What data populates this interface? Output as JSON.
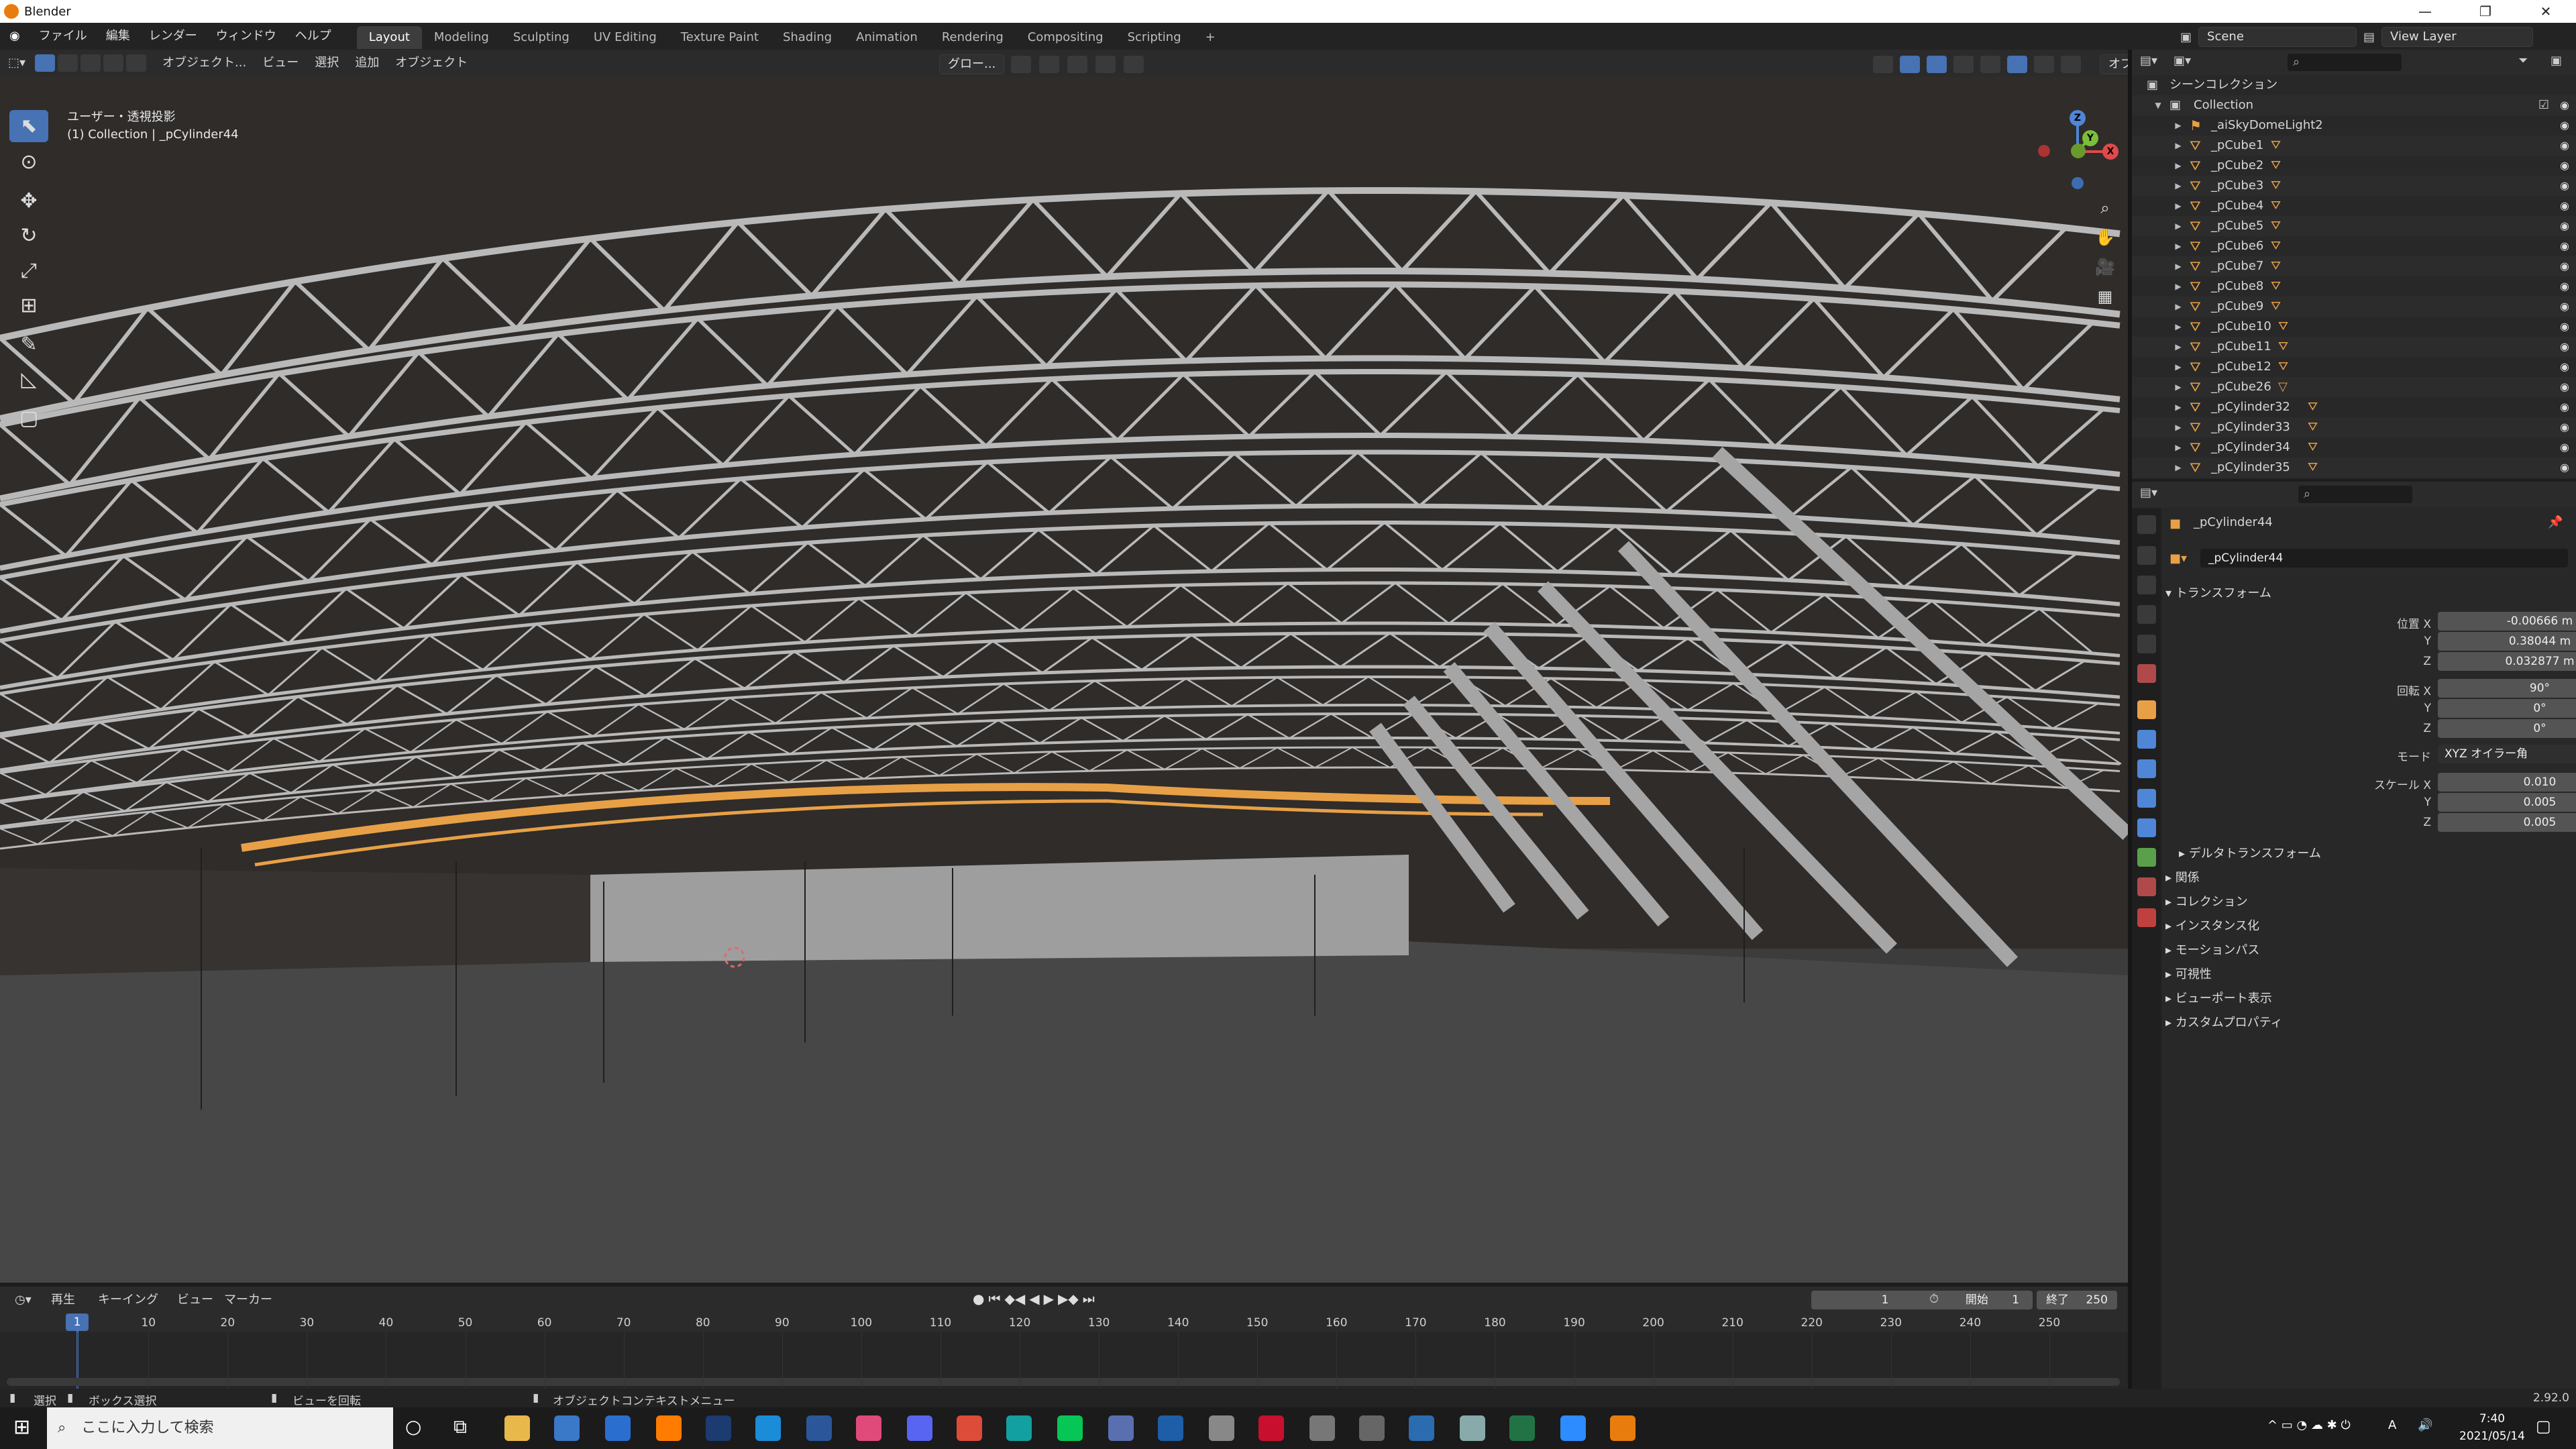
{
  "window": {
    "title": "Blender"
  },
  "topbar": {
    "menus": [
      "ファイル",
      "編集",
      "レンダー",
      "ウィンドウ",
      "ヘルプ"
    ],
    "workspaces": [
      "Layout",
      "Modeling",
      "Sculpting",
      "UV Editing",
      "Texture Paint",
      "Shading",
      "Animation",
      "Rendering",
      "Compositing",
      "Scripting"
    ],
    "active_workspace": "Layout",
    "scene": "Scene",
    "view_layer": "View Layer"
  },
  "viewport_header": {
    "mode": "オブジェクト...",
    "menus": [
      "ビュー",
      "選択",
      "追加",
      "オブジェクト"
    ],
    "transform_orientation": "グロー...",
    "options": "オプション"
  },
  "viewport": {
    "projection_label": "ユーザー・透視投影",
    "context_label": "(1) Collection | _pCylinder44",
    "gizmo": {
      "z": "Z",
      "y": "Y",
      "x": "X"
    }
  },
  "outliner": {
    "root": "シーンコレクション",
    "collection": "Collection",
    "items": [
      {
        "name": "_aiSkyDomeLight2",
        "type": "light"
      },
      {
        "name": "_pCube1",
        "type": "mesh"
      },
      {
        "name": "_pCube2",
        "type": "mesh"
      },
      {
        "name": "_pCube3",
        "type": "mesh"
      },
      {
        "name": "_pCube4",
        "type": "mesh"
      },
      {
        "name": "_pCube5",
        "type": "mesh"
      },
      {
        "name": "_pCube6",
        "type": "mesh"
      },
      {
        "name": "_pCube7",
        "type": "mesh"
      },
      {
        "name": "_pCube8",
        "type": "mesh"
      },
      {
        "name": "_pCube9",
        "type": "mesh"
      },
      {
        "name": "_pCube10",
        "type": "mesh"
      },
      {
        "name": "_pCube11",
        "type": "mesh"
      },
      {
        "name": "_pCube12",
        "type": "mesh"
      },
      {
        "name": "_pCube26",
        "type": "mesh-tri"
      },
      {
        "name": "_pCylinder32",
        "type": "mesh"
      },
      {
        "name": "_pCylinder33",
        "type": "mesh"
      },
      {
        "name": "_pCylinder34",
        "type": "mesh"
      },
      {
        "name": "_pCylinder35",
        "type": "mesh"
      }
    ]
  },
  "properties": {
    "object_name_header": "_pCylinder44",
    "object_name": "_pCylinder44",
    "transform_title": "トランスフォーム",
    "location_label": "位置 X",
    "location": [
      "-0.00666 m",
      "0.38044 m",
      "0.032877 m"
    ],
    "rotation_label": "回転 X",
    "rotation": [
      "90°",
      "0°",
      "0°"
    ],
    "mode_label": "モード",
    "mode_value": "XYZ オイラー角",
    "scale_label": "スケール X",
    "scale": [
      "0.010",
      "0.005",
      "0.005"
    ],
    "axis_y": "Y",
    "axis_z": "Z",
    "sub_panels": [
      "デルタトランスフォーム"
    ],
    "panels": [
      "関係",
      "コレクション",
      "インスタンス化",
      "モーションパス",
      "可視性",
      "ビューポート表示",
      "カスタムプロパティ"
    ]
  },
  "timeline": {
    "menus": [
      "再生",
      "キーイング",
      "ビュー",
      "マーカー"
    ],
    "current_frame": "1",
    "start_label": "開始",
    "start": "1",
    "end_label": "終了",
    "end": "250",
    "ticks": [
      "1",
      "10",
      "20",
      "30",
      "40",
      "50",
      "60",
      "70",
      "80",
      "90",
      "100",
      "110",
      "120",
      "130",
      "140",
      "150",
      "160",
      "170",
      "180",
      "190",
      "200",
      "210",
      "220",
      "230",
      "240",
      "250"
    ]
  },
  "statusbar": {
    "select": "選択",
    "box_select": "ボックス選択",
    "rotate_view": "ビューを回転",
    "context_menu": "オブジェクトコンテキストメニュー",
    "version": "2.92.0"
  },
  "taskbar": {
    "search_placeholder": "ここに入力して検索",
    "time": "7:40",
    "date": "2021/05/14",
    "ime": "A"
  },
  "colors": {
    "accent": "#4772b3",
    "selection": "#e8a046",
    "truss": "#b9b9b9"
  }
}
